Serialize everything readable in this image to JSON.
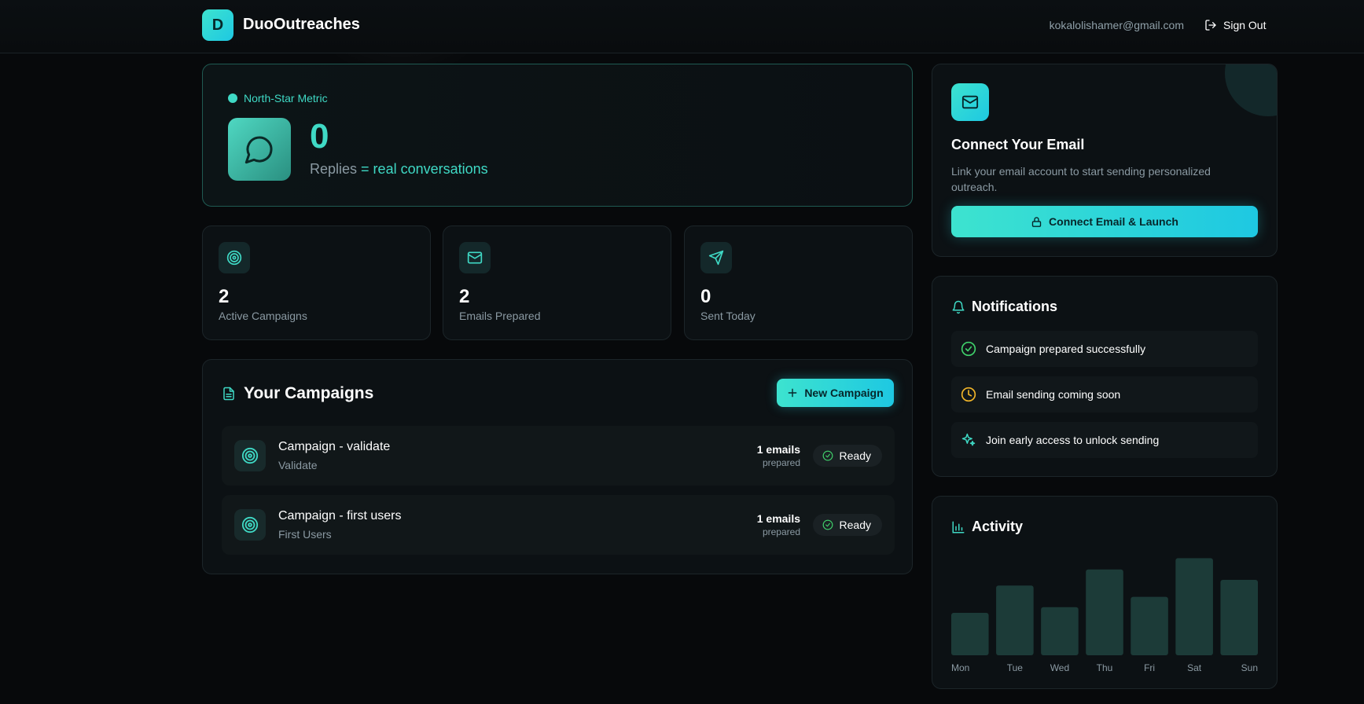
{
  "header": {
    "logo_letter": "D",
    "brand": "DuoOutreaches",
    "user_email": "kokalolishamer@gmail.com",
    "sign_out": "Sign Out"
  },
  "north_star": {
    "label": "North-Star Metric",
    "value": "0",
    "caption_main": "Replies",
    "caption_accent": "= real conversations"
  },
  "stats": [
    {
      "value": "2",
      "label": "Active Campaigns",
      "icon": "target-icon"
    },
    {
      "value": "2",
      "label": "Emails Prepared",
      "icon": "mail-icon"
    },
    {
      "value": "0",
      "label": "Sent Today",
      "icon": "send-icon"
    }
  ],
  "campaigns": {
    "title": "Your Campaigns",
    "new_button": "New Campaign",
    "items": [
      {
        "name": "Campaign - validate",
        "sub": "Validate",
        "count": "1 emails",
        "count_label": "prepared",
        "status": "Ready"
      },
      {
        "name": "Campaign - first users",
        "sub": "First Users",
        "count": "1 emails",
        "count_label": "prepared",
        "status": "Ready"
      }
    ]
  },
  "connect": {
    "title": "Connect Your Email",
    "description": "Link your email account to start sending personalized outreach.",
    "button": "Connect Email & Launch"
  },
  "notifications": {
    "title": "Notifications",
    "items": [
      {
        "text": "Campaign prepared successfully",
        "icon": "check-circle-icon",
        "color": "#3fcf6a"
      },
      {
        "text": "Email sending coming soon",
        "icon": "clock-icon",
        "color": "#f0b429"
      },
      {
        "text": "Join early access to unlock sending",
        "icon": "sparkle-icon",
        "color": "#3fd9c5"
      }
    ]
  },
  "activity": {
    "title": "Activity"
  },
  "chart_data": {
    "type": "bar",
    "categories": [
      "Mon",
      "Tue",
      "Wed",
      "Thu",
      "Fri",
      "Sat",
      "Sun"
    ],
    "values": [
      45,
      74,
      51,
      91,
      62,
      103,
      80
    ],
    "ylim": [
      0,
      110
    ],
    "grid": false
  },
  "colors": {
    "accent": "#3fd9c5",
    "accent_blue": "#1ec8e2",
    "background": "#07090b",
    "card": "#0c1114",
    "bar": "#1c3b38"
  }
}
